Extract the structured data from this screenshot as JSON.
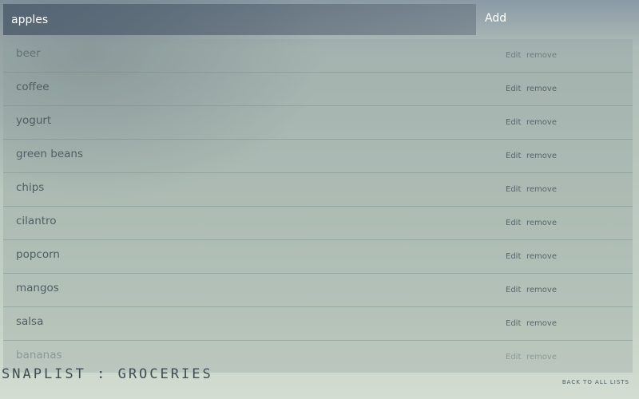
{
  "add_bar": {
    "input_value": "apples",
    "add_label": "Add"
  },
  "list": {
    "edit_label": "Edit",
    "remove_label": "remove",
    "items": [
      {
        "label": "beer"
      },
      {
        "label": "coffee"
      },
      {
        "label": "yogurt"
      },
      {
        "label": "green beans"
      },
      {
        "label": "chips"
      },
      {
        "label": "cilantro"
      },
      {
        "label": "popcorn"
      },
      {
        "label": "mangos"
      },
      {
        "label": "salsa"
      },
      {
        "label": "bananas"
      }
    ]
  },
  "footer": {
    "title": "SNAPLIST : GROCERIES",
    "back_link": "BACK TO ALL LISTS"
  }
}
